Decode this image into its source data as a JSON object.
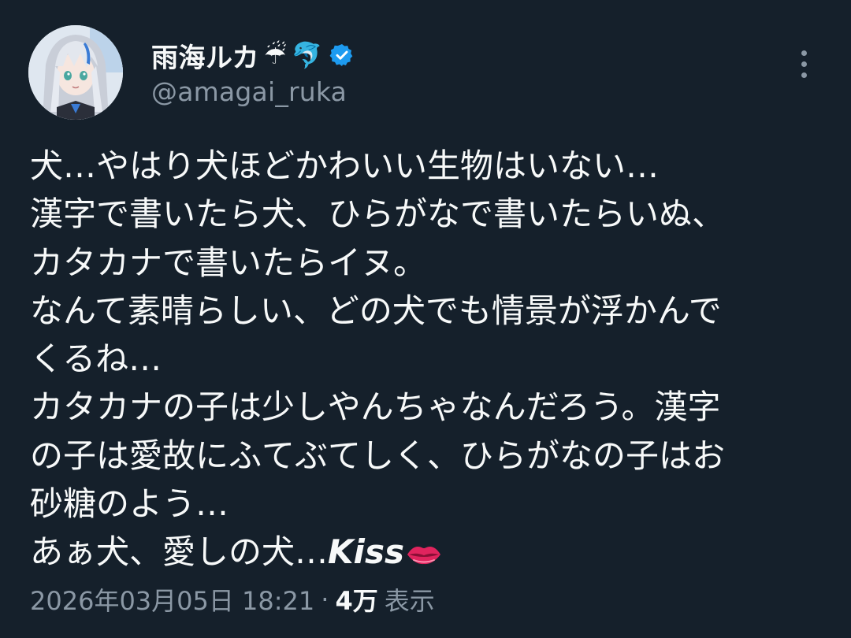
{
  "author": {
    "display_name": "雨海ルカ",
    "name_emojis": [
      "☔",
      "🐬"
    ],
    "verified": true,
    "handle": "@amagai_ruka"
  },
  "tweet": {
    "lines": [
      "犬…やはり犬ほどかわいい生物はいない…",
      "漢字で書いたら犬、ひらがなで書いたらいぬ、",
      "カタカナで書いたらイヌ。",
      "なんて素晴らしい、どの犬でも情景が浮かんで",
      "くるね…",
      "カタカナの子は少しやんちゃなんだろう。漢字",
      "の子は愛故にふてぶてしく、ひらがなの子はお",
      "砂糖のよう…"
    ],
    "last_line_prefix": "あぁ犬、愛しの犬…",
    "last_line_kiss": "Kiss",
    "last_line_emoji": "lips-icon"
  },
  "meta": {
    "timestamp": "2026年03月05日 18:21",
    "separator": "·",
    "views_count": "4万",
    "views_label": "表示"
  },
  "colors": {
    "background": "#15202b",
    "text_primary": "#f7f9f9",
    "text_secondary": "#8b98a5",
    "verified_blue": "#1d9bf0"
  },
  "icons": {
    "more": "more-vertical-icon",
    "verified": "verified-badge-icon",
    "avatar": "avatar-anime-girl"
  }
}
